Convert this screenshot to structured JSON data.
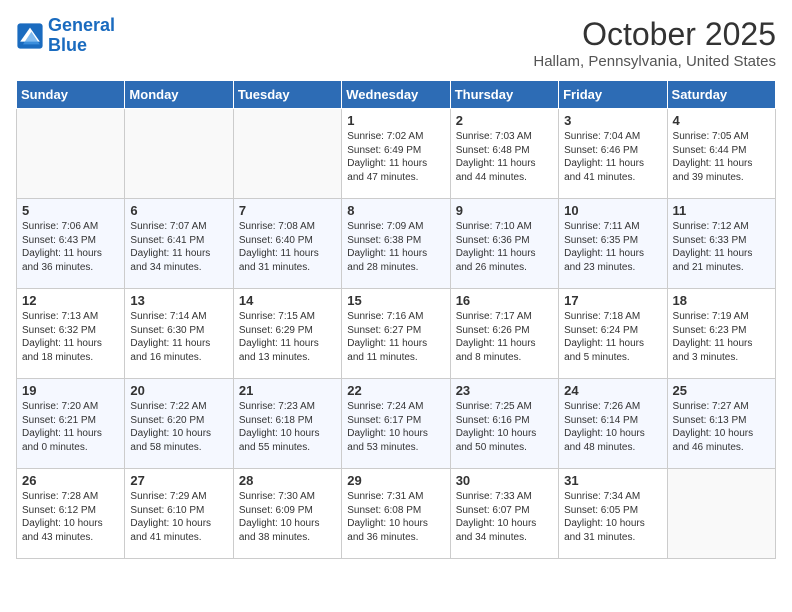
{
  "header": {
    "logo_line1": "General",
    "logo_line2": "Blue",
    "month": "October 2025",
    "location": "Hallam, Pennsylvania, United States"
  },
  "days_of_week": [
    "Sunday",
    "Monday",
    "Tuesday",
    "Wednesday",
    "Thursday",
    "Friday",
    "Saturday"
  ],
  "weeks": [
    [
      {
        "day": "",
        "info": ""
      },
      {
        "day": "",
        "info": ""
      },
      {
        "day": "",
        "info": ""
      },
      {
        "day": "1",
        "info": "Sunrise: 7:02 AM\nSunset: 6:49 PM\nDaylight: 11 hours\nand 47 minutes."
      },
      {
        "day": "2",
        "info": "Sunrise: 7:03 AM\nSunset: 6:48 PM\nDaylight: 11 hours\nand 44 minutes."
      },
      {
        "day": "3",
        "info": "Sunrise: 7:04 AM\nSunset: 6:46 PM\nDaylight: 11 hours\nand 41 minutes."
      },
      {
        "day": "4",
        "info": "Sunrise: 7:05 AM\nSunset: 6:44 PM\nDaylight: 11 hours\nand 39 minutes."
      }
    ],
    [
      {
        "day": "5",
        "info": "Sunrise: 7:06 AM\nSunset: 6:43 PM\nDaylight: 11 hours\nand 36 minutes."
      },
      {
        "day": "6",
        "info": "Sunrise: 7:07 AM\nSunset: 6:41 PM\nDaylight: 11 hours\nand 34 minutes."
      },
      {
        "day": "7",
        "info": "Sunrise: 7:08 AM\nSunset: 6:40 PM\nDaylight: 11 hours\nand 31 minutes."
      },
      {
        "day": "8",
        "info": "Sunrise: 7:09 AM\nSunset: 6:38 PM\nDaylight: 11 hours\nand 28 minutes."
      },
      {
        "day": "9",
        "info": "Sunrise: 7:10 AM\nSunset: 6:36 PM\nDaylight: 11 hours\nand 26 minutes."
      },
      {
        "day": "10",
        "info": "Sunrise: 7:11 AM\nSunset: 6:35 PM\nDaylight: 11 hours\nand 23 minutes."
      },
      {
        "day": "11",
        "info": "Sunrise: 7:12 AM\nSunset: 6:33 PM\nDaylight: 11 hours\nand 21 minutes."
      }
    ],
    [
      {
        "day": "12",
        "info": "Sunrise: 7:13 AM\nSunset: 6:32 PM\nDaylight: 11 hours\nand 18 minutes."
      },
      {
        "day": "13",
        "info": "Sunrise: 7:14 AM\nSunset: 6:30 PM\nDaylight: 11 hours\nand 16 minutes."
      },
      {
        "day": "14",
        "info": "Sunrise: 7:15 AM\nSunset: 6:29 PM\nDaylight: 11 hours\nand 13 minutes."
      },
      {
        "day": "15",
        "info": "Sunrise: 7:16 AM\nSunset: 6:27 PM\nDaylight: 11 hours\nand 11 minutes."
      },
      {
        "day": "16",
        "info": "Sunrise: 7:17 AM\nSunset: 6:26 PM\nDaylight: 11 hours\nand 8 minutes."
      },
      {
        "day": "17",
        "info": "Sunrise: 7:18 AM\nSunset: 6:24 PM\nDaylight: 11 hours\nand 5 minutes."
      },
      {
        "day": "18",
        "info": "Sunrise: 7:19 AM\nSunset: 6:23 PM\nDaylight: 11 hours\nand 3 minutes."
      }
    ],
    [
      {
        "day": "19",
        "info": "Sunrise: 7:20 AM\nSunset: 6:21 PM\nDaylight: 11 hours\nand 0 minutes."
      },
      {
        "day": "20",
        "info": "Sunrise: 7:22 AM\nSunset: 6:20 PM\nDaylight: 10 hours\nand 58 minutes."
      },
      {
        "day": "21",
        "info": "Sunrise: 7:23 AM\nSunset: 6:18 PM\nDaylight: 10 hours\nand 55 minutes."
      },
      {
        "day": "22",
        "info": "Sunrise: 7:24 AM\nSunset: 6:17 PM\nDaylight: 10 hours\nand 53 minutes."
      },
      {
        "day": "23",
        "info": "Sunrise: 7:25 AM\nSunset: 6:16 PM\nDaylight: 10 hours\nand 50 minutes."
      },
      {
        "day": "24",
        "info": "Sunrise: 7:26 AM\nSunset: 6:14 PM\nDaylight: 10 hours\nand 48 minutes."
      },
      {
        "day": "25",
        "info": "Sunrise: 7:27 AM\nSunset: 6:13 PM\nDaylight: 10 hours\nand 46 minutes."
      }
    ],
    [
      {
        "day": "26",
        "info": "Sunrise: 7:28 AM\nSunset: 6:12 PM\nDaylight: 10 hours\nand 43 minutes."
      },
      {
        "day": "27",
        "info": "Sunrise: 7:29 AM\nSunset: 6:10 PM\nDaylight: 10 hours\nand 41 minutes."
      },
      {
        "day": "28",
        "info": "Sunrise: 7:30 AM\nSunset: 6:09 PM\nDaylight: 10 hours\nand 38 minutes."
      },
      {
        "day": "29",
        "info": "Sunrise: 7:31 AM\nSunset: 6:08 PM\nDaylight: 10 hours\nand 36 minutes."
      },
      {
        "day": "30",
        "info": "Sunrise: 7:33 AM\nSunset: 6:07 PM\nDaylight: 10 hours\nand 34 minutes."
      },
      {
        "day": "31",
        "info": "Sunrise: 7:34 AM\nSunset: 6:05 PM\nDaylight: 10 hours\nand 31 minutes."
      },
      {
        "day": "",
        "info": ""
      }
    ]
  ]
}
